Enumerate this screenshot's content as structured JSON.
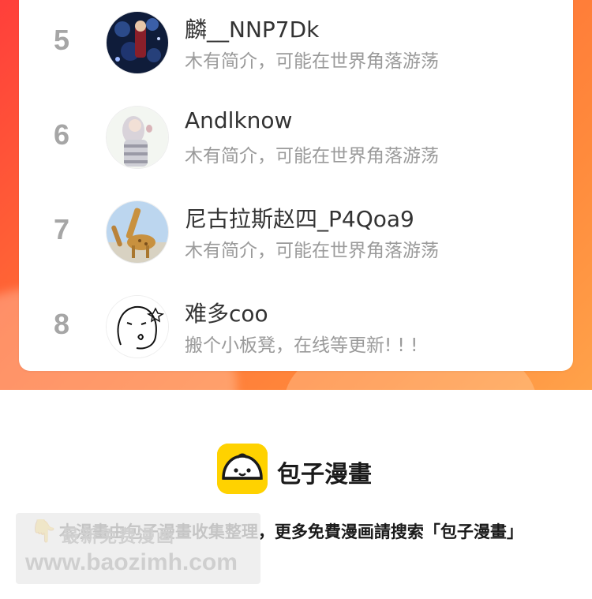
{
  "ranking": {
    "rows": [
      {
        "rank": "5",
        "name": "麟__NNP7Dk",
        "bio": "木有简介，可能在世界角落游荡"
      },
      {
        "rank": "6",
        "name": "Andlknow",
        "bio": "木有简介，可能在世界角落游荡"
      },
      {
        "rank": "7",
        "name": "尼古拉斯赵四_P4Qoa9",
        "bio": "木有简介，可能在世界角落游荡"
      },
      {
        "rank": "8",
        "name": "难多coo",
        "bio": "搬个小板凳，在线等更新! ! !"
      }
    ]
  },
  "brand": {
    "name": "包子漫畫"
  },
  "footer": {
    "notice": "本漫畫由包子漫畫收集整理，更多免費漫画請搜索「包子漫畫」",
    "hand_icon": "👇"
  },
  "watermark": {
    "line1": "最新免费漫画",
    "line2": "www.baozimh.com"
  },
  "colors": {
    "banner_start": "#ff3f3b",
    "banner_end": "#ffa24a",
    "rank_gray": "#a6a6a6",
    "brand_yellow": "#ffd200"
  }
}
